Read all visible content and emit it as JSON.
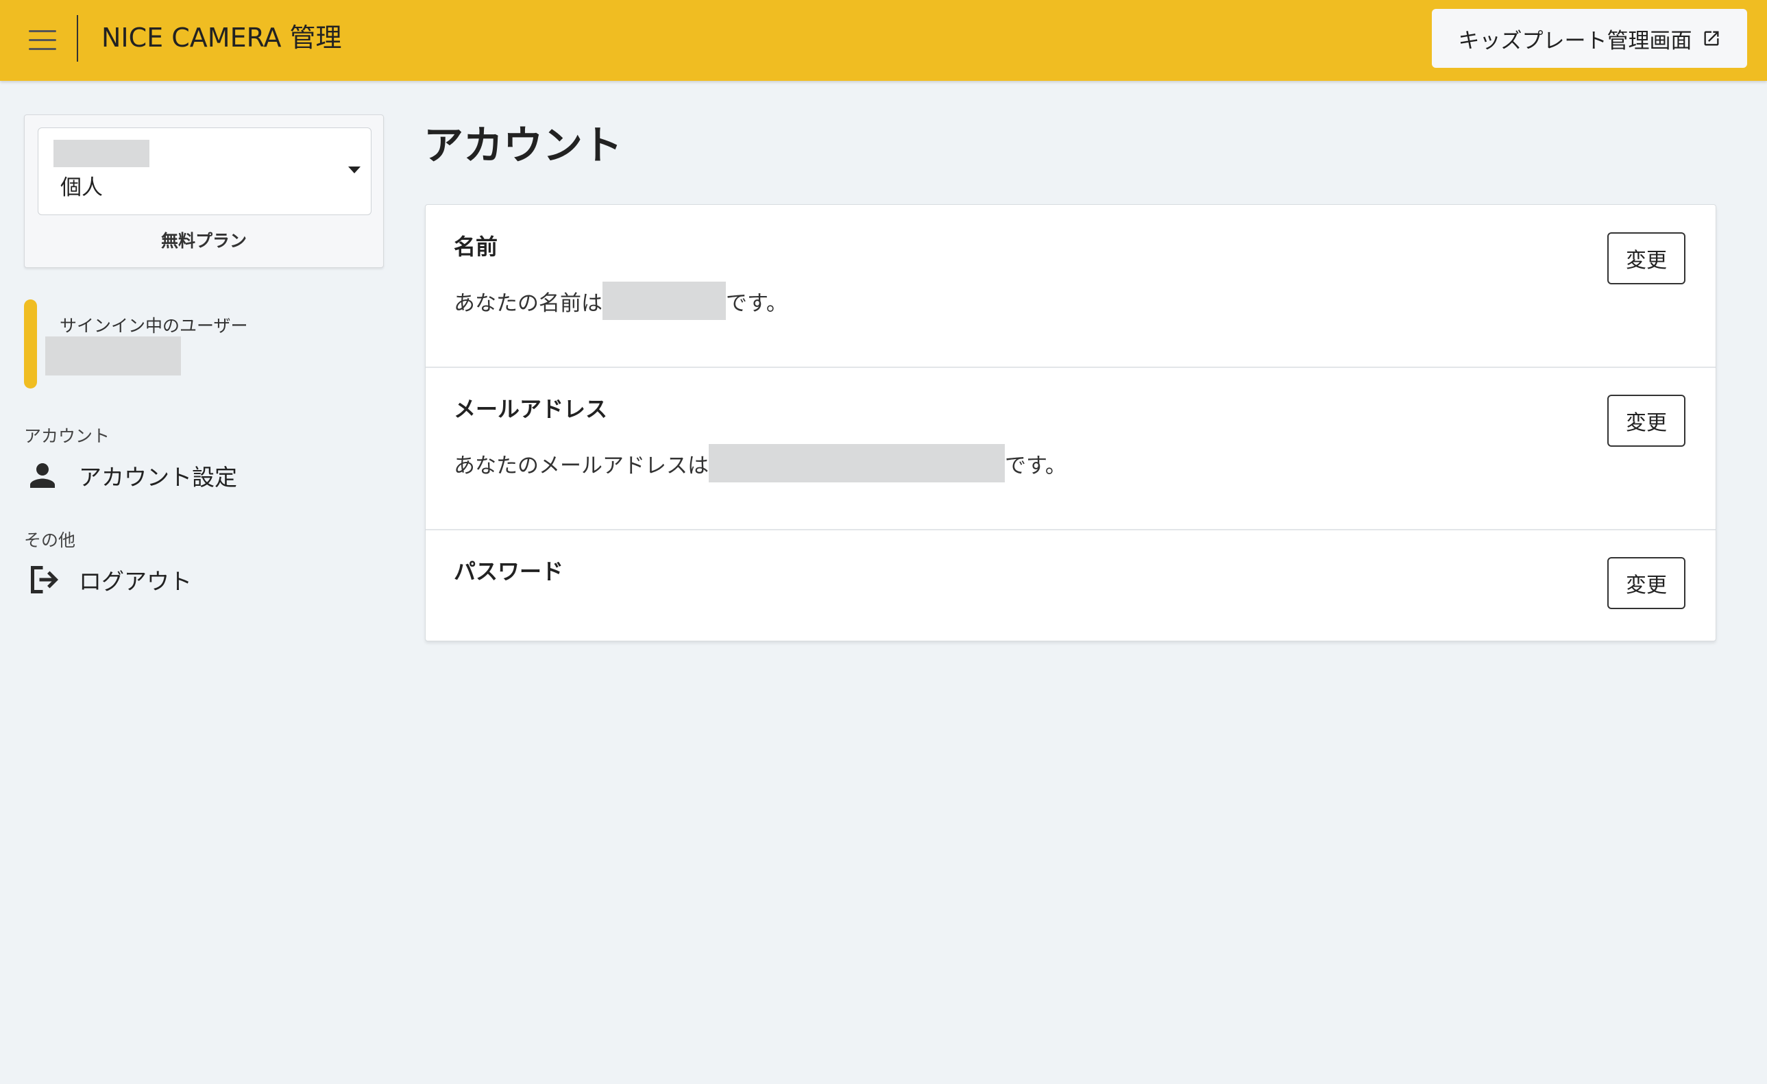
{
  "header": {
    "app_title": "NICE CAMERA 管理",
    "external_button_label": "キッズプレート管理画面",
    "accent_color": "#f0bd22"
  },
  "sidebar": {
    "org_selector": {
      "type_label": "個人",
      "plan_label": "無料プラン"
    },
    "signed_in_label": "サインイン中のユーザー",
    "sections": [
      {
        "label": "アカウント",
        "items": [
          {
            "label": "アカウント設定",
            "icon": "person-icon"
          }
        ]
      },
      {
        "label": "その他",
        "items": [
          {
            "label": "ログアウト",
            "icon": "logout-icon"
          }
        ]
      }
    ]
  },
  "main": {
    "page_title": "アカウント",
    "rows": [
      {
        "heading": "名前",
        "text_prefix": "あなたの名前は",
        "text_suffix": "です。",
        "button_label": "変更"
      },
      {
        "heading": "メールアドレス",
        "text_prefix": "あなたのメールアドレスは",
        "text_suffix": "です。",
        "button_label": "変更"
      },
      {
        "heading": "パスワード",
        "button_label": "変更"
      }
    ]
  }
}
